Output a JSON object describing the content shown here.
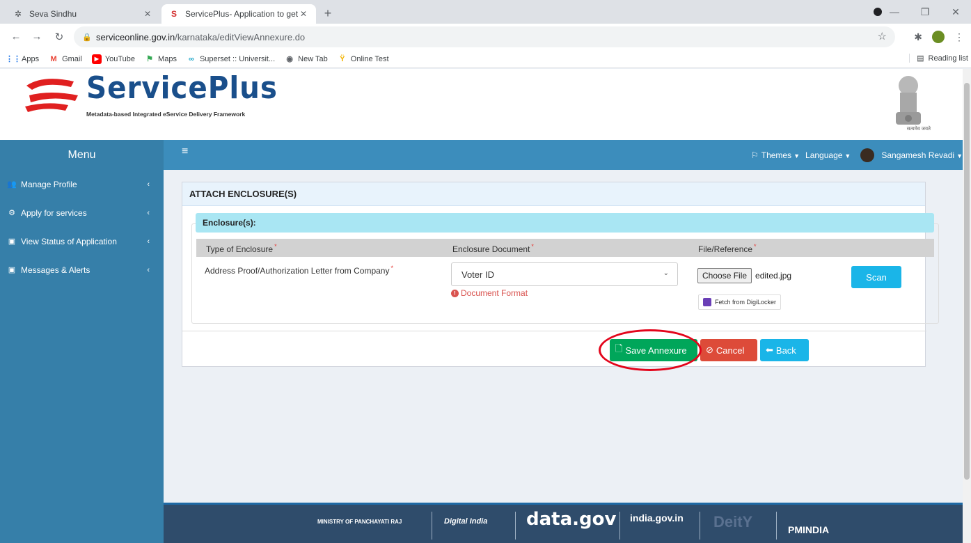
{
  "browser": {
    "tabs": [
      {
        "title": "Seva Sindhu",
        "active": false
      },
      {
        "title": "ServicePlus- Application to get P",
        "active": true
      }
    ],
    "url_host": "serviceonline.gov.in",
    "url_path": "/karnataka/editViewAnnexure.do",
    "bookmarks": [
      "Apps",
      "Gmail",
      "YouTube",
      "Maps",
      "Superset :: Universit...",
      "New Tab",
      "Online Test"
    ],
    "reading_list": "Reading list"
  },
  "header": {
    "logo_text": "ServicePlus",
    "logo_subtitle": "Metadata-based Integrated eService Delivery Framework",
    "emblem_caption": "सत्यमेव जयते"
  },
  "navbar": {
    "menu_label": "Menu",
    "themes": "Themes",
    "language": "Language",
    "user_name": "Sangamesh Revadi"
  },
  "sidebar": {
    "items": [
      {
        "label": "Manage Profile",
        "icon": "users-icon"
      },
      {
        "label": "Apply for services",
        "icon": "gears-icon"
      },
      {
        "label": "View Status of Application",
        "icon": "window-icon"
      },
      {
        "label": "Messages & Alerts",
        "icon": "window-icon"
      }
    ]
  },
  "panel": {
    "title": "ATTACH ENCLOSURE(S)",
    "section_title": "Enclosure(s):",
    "columns": [
      "Type of Enclosure",
      "Enclosure Document",
      "File/Reference"
    ],
    "row": {
      "type": "Address Proof/Authorization Letter from Company",
      "document_selected": "Voter ID",
      "format_hint": "Document Format",
      "choose_file_label": "Choose File",
      "file_name": "edited.jpg",
      "scan_label": "Scan",
      "digilocker_label": "Fetch from DigiLocker"
    },
    "actions": {
      "save": "Save Annexure",
      "cancel": "Cancel",
      "back": "Back"
    }
  },
  "footer": {
    "logos": [
      "MINISTRY OF PANCHAYATI RAJ",
      "Digital India",
      "data.gov",
      "india.gov.in",
      "DeitY",
      "PMINDIA"
    ]
  },
  "colors": {
    "navbar": "#3c8dbc",
    "sidebar": "#367fa9",
    "save": "#00a65a",
    "cancel": "#dd4b39",
    "back": "#1ab5e8",
    "highlight": "#e3051b"
  }
}
